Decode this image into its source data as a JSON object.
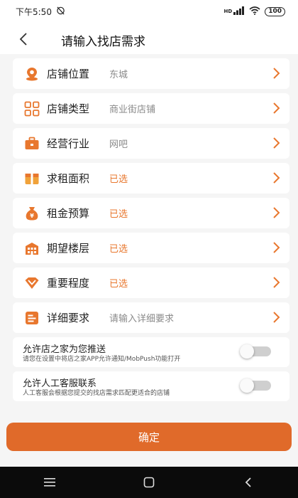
{
  "status_bar": {
    "time": "下午5:50",
    "battery": "100",
    "network_label": "HD"
  },
  "header": {
    "title": "请输入找店需求"
  },
  "rows": [
    {
      "label": "店铺位置",
      "value": "东城",
      "value_state": "filled",
      "icon": "location-pin-icon"
    },
    {
      "label": "店铺类型",
      "value": "商业街店铺",
      "value_state": "filled",
      "icon": "grid-icon"
    },
    {
      "label": "经营行业",
      "value": "网吧",
      "value_state": "filled",
      "icon": "briefcase-icon"
    },
    {
      "label": "求租面积",
      "value": "已选",
      "value_state": "selected",
      "icon": "box-icon"
    },
    {
      "label": "租金预算",
      "value": "已选",
      "value_state": "selected",
      "icon": "money-bag-icon"
    },
    {
      "label": "期望楼层",
      "value": "已选",
      "value_state": "selected",
      "icon": "building-icon"
    },
    {
      "label": "重要程度",
      "value": "已选",
      "value_state": "selected",
      "icon": "diamond-icon"
    },
    {
      "label": "详细要求",
      "value": "请输入详细要求",
      "value_state": "placeholder",
      "icon": "document-icon"
    }
  ],
  "toggles": [
    {
      "title": "允许店之家为您推送",
      "description": "请您在设置中将店之家APP允许通知/MobPush功能打开",
      "on": false
    },
    {
      "title": "允许人工客服联系",
      "description": "人工客服会根据您提交的找店需求匹配更适合的店铺",
      "on": false
    }
  ],
  "confirm": {
    "label": "确定"
  },
  "colors": {
    "accent": "#e8772e",
    "button": "#e06a2a",
    "background": "#f5f5f5"
  }
}
